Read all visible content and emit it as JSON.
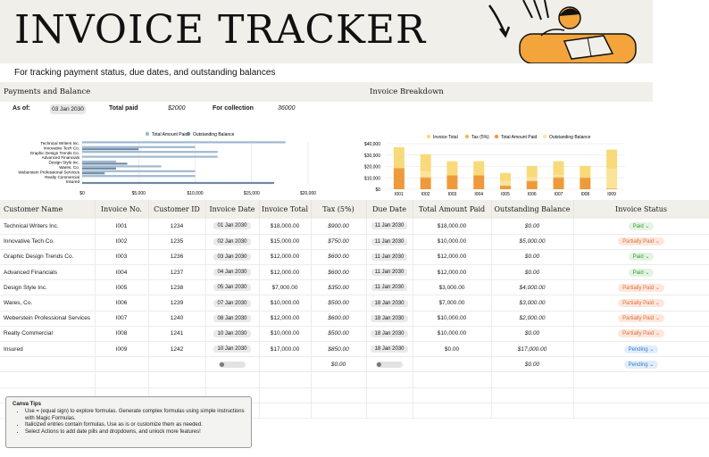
{
  "header": {
    "title": "INVOICE TRACKER",
    "subtitle": "For tracking payment status, due dates, and outstanding balances"
  },
  "sections": {
    "payments": "Payments and Balance",
    "breakdown": "Invoice Breakdown"
  },
  "summary": {
    "as_of_label": "As of:",
    "as_of_value": "03 Jan 2030",
    "total_paid_label": "Total paid",
    "total_paid_value": "$2000",
    "for_collection_label": "For collection",
    "for_collection_value": "36000"
  },
  "colors": {
    "header_bg": "#f1efe9",
    "blue_light": "#9fb8cf",
    "blue_dark": "#6f8aa3",
    "invoice_total": "#f8da7a",
    "tax": "#f6b45a",
    "total_paid": "#ee9a3a",
    "outstanding": "#fbe49a",
    "paid": "#3a9a3a",
    "partial": "#e0703a",
    "pending": "#3a7ad0"
  },
  "chart_data": [
    {
      "type": "bar",
      "orientation": "horizontal",
      "categories": [
        "Technical Writers Inc.",
        "Innovative Tech Co.",
        "Graphic Design Trends Co.",
        "Advanced Financials",
        "Design Style Inc.",
        "Wares, Co.",
        "Weberstein Professional Services",
        "Realty Commercial",
        "Insured"
      ],
      "series": [
        {
          "name": "Total Amount Paid",
          "values": [
            18000,
            10000,
            12000,
            12000,
            3000,
            7000,
            10000,
            10000,
            0
          ]
        },
        {
          "name": "Outstanding Balance",
          "values": [
            0,
            5000,
            0,
            0,
            4000,
            3000,
            2000,
            0,
            17000
          ]
        }
      ],
      "xticks": [
        "$0",
        "$5,000",
        "$10,000",
        "$15,000",
        "$20,000"
      ],
      "xlim": [
        0,
        20000
      ],
      "legend": "top"
    },
    {
      "type": "bar",
      "stacked": true,
      "categories": [
        "I001",
        "I002",
        "I003",
        "I004",
        "I005",
        "I006",
        "I007",
        "I008",
        "I009"
      ],
      "series": [
        {
          "name": "Invoice Total",
          "values": [
            18000,
            15000,
            12000,
            12000,
            7000,
            10000,
            12000,
            10000,
            17000
          ]
        },
        {
          "name": "Tax (5%)",
          "values": [
            900,
            750,
            600,
            600,
            350,
            500,
            600,
            500,
            850
          ]
        },
        {
          "name": "Total Amount Paid",
          "values": [
            18000,
            10000,
            12000,
            12000,
            3000,
            7000,
            10000,
            10000,
            0
          ]
        },
        {
          "name": "Outstanding Balance",
          "values": [
            0,
            5000,
            0,
            0,
            4000,
            3000,
            2000,
            0,
            17000
          ]
        }
      ],
      "yticks": [
        "$0",
        "$10,000",
        "$20,000",
        "$30,000",
        "$40,000"
      ],
      "ylim": [
        0,
        40000
      ],
      "legend": "top"
    }
  ],
  "table": {
    "headers": [
      "Customer Name",
      "Invoice No.",
      "Customer ID",
      "Invoice Date",
      "Invoice Total",
      "Tax (5%)",
      "Due Date",
      "Total Amount Paid",
      "Outstanding Balance",
      "Invoice Status"
    ],
    "rows": [
      [
        "Technical Writers Inc.",
        "I001",
        "1234",
        "01 Jan 2030",
        "$18,000.00",
        "$900.00",
        "11 Jan 2030",
        "$18,000.00",
        "$0.00",
        "Paid"
      ],
      [
        "Innovative Tech Co.",
        "I002",
        "1235",
        "02 Jan 2030",
        "$15,000.00",
        "$750.00",
        "11 Jan 2030",
        "$10,000.00",
        "$5,000.00",
        "Partially Paid"
      ],
      [
        "Graphic Design Trends Co.",
        "I003",
        "1236",
        "03 Jan 2030",
        "$12,000.00",
        "$600.00",
        "11 Jan 2030",
        "$12,000.00",
        "$0.00",
        "Paid"
      ],
      [
        "Advanced Financials",
        "I004",
        "1237",
        "04 Jan 2030",
        "$12,000.00",
        "$600.00",
        "11 Jan 2030",
        "$12,000.00",
        "$0.00",
        "Paid"
      ],
      [
        "Design Style Inc.",
        "I005",
        "1238",
        "05 Jan 2030",
        "$7,000.00",
        "$350.00",
        "11 Jan 2030",
        "$3,000.00",
        "$4,000.00",
        "Partially Paid"
      ],
      [
        "Wares, Co.",
        "I006",
        "1239",
        "07 Jan 2030",
        "$10,000.00",
        "$500.00",
        "18 Jan 2030",
        "$7,000.00",
        "$3,000.00",
        "Partially Paid"
      ],
      [
        "Weberstein Professional Services",
        "I007",
        "1240",
        "08 Jan 2030",
        "$12,000.00",
        "$600.00",
        "18 Jan 2030",
        "$10,000.00",
        "$2,000.00",
        "Partially Paid"
      ],
      [
        "Realty Commercial",
        "I008",
        "1241",
        "10 Jan 2030",
        "$10,000.00",
        "$500.00",
        "18 Jan 2030",
        "$10,000.00",
        "$0.00",
        "Partially Paid"
      ],
      [
        "Insured",
        "I009",
        "1242",
        "10 Jan 2030",
        "$17,000.00",
        "$850.00",
        "18 Jan 2030",
        "$0.00",
        "$17,000.00",
        "Pending"
      ]
    ],
    "totals": {
      "tax": "$0.00",
      "outstanding": "$0.00",
      "status": "Pending"
    }
  },
  "tips": {
    "title": "Canva Tips",
    "items": [
      "Use = (equal sign) to explore formulas. Generate complex formulas using simple instructions with Magic Formulas.",
      "Italicized entries contain formulas. Use as is or customize them as needed.",
      "Select Actions to add date pills and dropdowns, and unlock more features!"
    ]
  }
}
